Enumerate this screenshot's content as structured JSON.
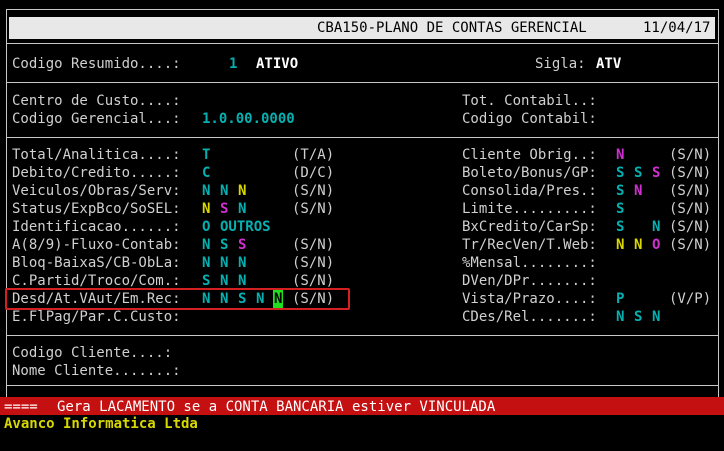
{
  "header": {
    "title": "CBA150-PLANO DE CONTAS GERENCIAL",
    "date": "11/04/17"
  },
  "resumido": {
    "label": "Codigo Resumido....:",
    "code": "1",
    "name": "ATIVO",
    "sigla_label": "Sigla:",
    "sigla": "ATV"
  },
  "centro_custo": {
    "label": "Centro de Custo....:"
  },
  "cod_gerencial": {
    "label": "Codigo Gerencial...:",
    "value": "1.0.00.0000"
  },
  "tot_contabil": {
    "label": "Tot. Contabil..:"
  },
  "cod_contabil": {
    "label": "Codigo Contabil:"
  },
  "left_fields": [
    {
      "label": "Total/Analitica....:",
      "hint": "(T/A)",
      "values": [
        "T"
      ]
    },
    {
      "label": "Debito/Credito.....:",
      "hint": "(D/C)",
      "values": [
        "C"
      ]
    },
    {
      "label": "Veiculos/Obras/Serv:",
      "hint": "(S/N)",
      "values": [
        "N",
        "N",
        "N"
      ]
    },
    {
      "label": "Status/ExpBco/SoSEL:",
      "hint": "(S/N)",
      "values": [
        "N",
        "S",
        "N"
      ]
    },
    {
      "label": "Identificacao......:",
      "values": [
        "O",
        "OUTROS"
      ]
    },
    {
      "label": "A(8/9)-Fluxo-Contab:",
      "hint": "(S/N)",
      "values": [
        "N",
        "S",
        "S"
      ]
    },
    {
      "label": "Bloq-BaixaS/CB-ObLa:",
      "hint": "(S/N)",
      "values": [
        "N",
        "N",
        "N"
      ]
    },
    {
      "label": "C.Partid/Troco/Com.:",
      "hint": "(S/N)",
      "values": [
        "S",
        "N",
        "N"
      ]
    },
    {
      "label": "Desd/At.VAut/Em.Rec:",
      "hint": "(S/N)",
      "values": [
        "N",
        "N",
        "S",
        "N",
        "N"
      ]
    },
    {
      "label": "E.FlPag/Par.C.Custo:"
    }
  ],
  "right_fields": [
    {
      "label": "Cliente Obrig..:",
      "hint": "(S/N)",
      "values": [
        "N"
      ]
    },
    {
      "label": "Boleto/Bonus/GP:",
      "hint": "(S/N)",
      "values": [
        "S",
        "S",
        "S"
      ]
    },
    {
      "label": "Consolida/Pres.:",
      "hint": "(S/N)",
      "values": [
        "S",
        "N"
      ]
    },
    {
      "label": "Limite.........:",
      "hint": "(S/N)",
      "values": [
        "S"
      ]
    },
    {
      "label": "BxCredito/CarSp:",
      "hint": "(S/N)",
      "values": [
        "S",
        "N"
      ]
    },
    {
      "label": "Tr/RecVen/T.Web:",
      "hint": "(S/N)",
      "values": [
        "N",
        "N",
        "O"
      ]
    },
    {
      "label": "%Mensal........:"
    },
    {
      "label": "DVen/DPr.......:"
    },
    {
      "label": "Vista/Prazo....:",
      "hint": "(V/P)",
      "values": [
        "P"
      ]
    },
    {
      "label": "CDes/Rel.......:",
      "values": [
        "N",
        "S",
        "N"
      ]
    }
  ],
  "cliente": {
    "codigo_label": "Codigo Cliente....:",
    "nome_label": "Nome Cliente.......:"
  },
  "status_bar": {
    "marker": "====",
    "message": "Gera LACAMENTO se a CONTA BANCARIA estiver VINCULADA"
  },
  "footer": {
    "company": "Avanco Informatica Ltda"
  },
  "colors": {
    "cyan": "#06b0b0",
    "magenta": "#d030d0",
    "yellow": "#d8d800",
    "red_bar": "#c41010",
    "highlight": "#d42020",
    "cursor": "#20e020"
  }
}
